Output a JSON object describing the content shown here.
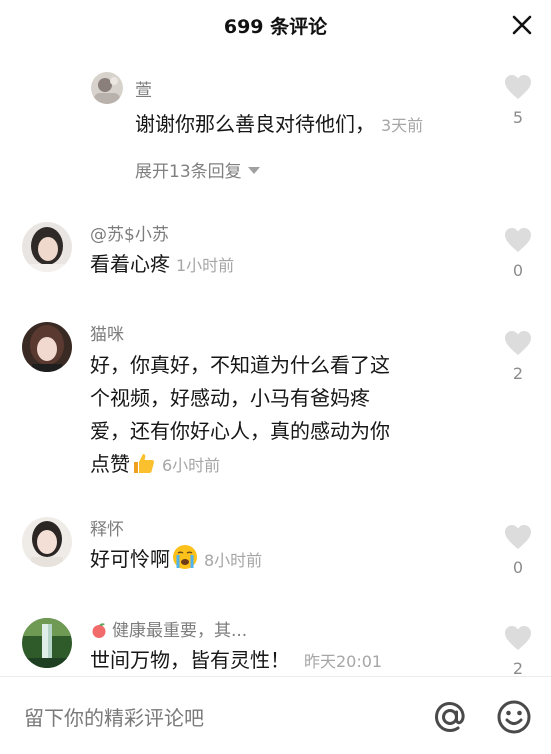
{
  "header": {
    "title": "699 条评论"
  },
  "comments": [
    {
      "username": "萱",
      "text": "谢谢你那么善良对待他们，",
      "time": "3天前",
      "likes": "5",
      "expand_replies": "展开13条回复"
    },
    {
      "username": "@苏$小苏",
      "text": "看着心疼",
      "time": "1小时前",
      "likes": "0"
    },
    {
      "username": "猫咪",
      "text_lines": [
        "好，你真好，不知道为什么看了这",
        "个视频，好感动，小马有爸妈疼",
        "爱，还有你好心人，真的感动为你",
        "点赞"
      ],
      "text_emoji": "thumbs-up",
      "time": "6小时前",
      "likes": "2"
    },
    {
      "username": "释怀",
      "text": "好可怜啊",
      "text_emoji": "crying-face",
      "time": "8小时前",
      "likes": "0"
    },
    {
      "username": "健康最重要，其...",
      "username_emoji": "peach",
      "text": "世间万物，皆有灵性！",
      "time": "昨天20:01",
      "likes": "2"
    }
  ],
  "composer": {
    "placeholder": "留下你的精彩评论吧"
  },
  "icons": {
    "close": "close-icon",
    "like": "heart-icon",
    "at": "at-icon",
    "emoji": "smiley-icon"
  },
  "colors": {
    "like_heart": "#dcdcdc",
    "username": "#7d7d7d",
    "timestamp": "#a6a6a6"
  }
}
